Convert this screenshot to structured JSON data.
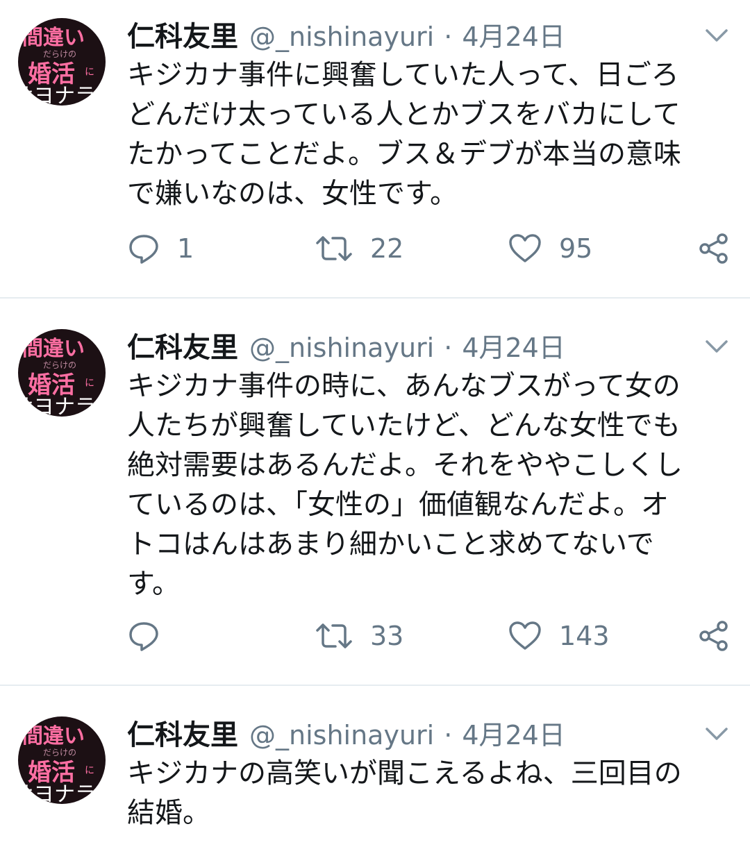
{
  "tweets": [
    {
      "name": "仁科友里",
      "handle": "@_nishinayuri",
      "separator": "·",
      "date": "4月24日",
      "text": "キジカナ事件に興奮していた人って、日ごろ\nどんだけ太っている人とかブスをバカにして\nたかってことだよ。ブス＆デブが本当の意味\nで嫌いなのは、女性です。",
      "reply_count": "1",
      "retweet_count": "22",
      "like_count": "95"
    },
    {
      "name": "仁科友里",
      "handle": "@_nishinayuri",
      "separator": "·",
      "date": "4月24日",
      "text": "キジカナ事件の時に、あんなブスがって女の\n人たちが興奮していたけど、どんな女性でも\n絶対需要はあるんだよ。それをややこしくし\nているのは、「女性の」価値観なんだよ。オ\nトコはんはあまり細かいこと求めてないで\nす。",
      "reply_count": "",
      "retweet_count": "33",
      "like_count": "143"
    },
    {
      "name": "仁科友里",
      "handle": "@_nishinayuri",
      "separator": "·",
      "date": "4月24日",
      "text": "キジカナの高笑いが聞こえるよね、三回目の\n結婚。"
    }
  ],
  "avatar_text": {
    "line1": "間違い",
    "line2": "だらけの",
    "line3": "婚活",
    "line3_small": "に",
    "line4": "サヨナラ"
  },
  "icons": {
    "reply": "reply-icon",
    "retweet": "retweet-icon",
    "like": "heart-icon",
    "share": "share-icon",
    "menu": "chevron-down-icon"
  },
  "colors": {
    "name": "#14171a",
    "meta": "#657786",
    "divider": "#e6ecf0",
    "avatar_bg": "#1c1014",
    "avatar_text": "#ff6fa3"
  }
}
